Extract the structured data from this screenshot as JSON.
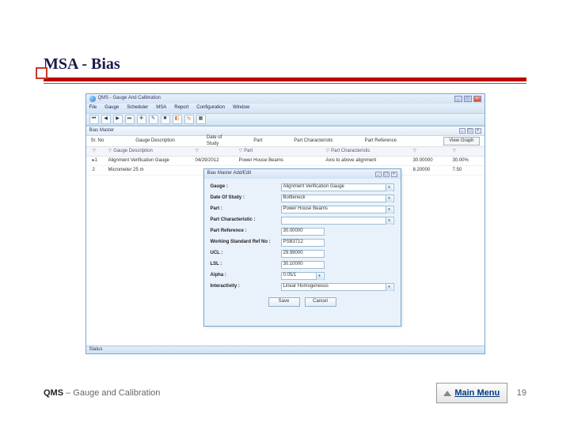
{
  "slide": {
    "title": "MSA - Bias",
    "footer_left_prefix": "QMS",
    "footer_left_rest": " – Gauge and Calibration",
    "main_menu_label": "Main Menu",
    "page_number": "19"
  },
  "window": {
    "title": "QMS - Gauge And Calibration",
    "menubar": [
      "File",
      "Gauge",
      "Scheduler",
      "MSA",
      "Report",
      "Configuration",
      "Window"
    ],
    "sub_title": "Bias Master",
    "header": {
      "srno_label": "Sr. No",
      "gauge_desc_label": "Gauge Description",
      "date_label": "Date of",
      "study_label": "Study",
      "part_label": "Part",
      "partchar_label": "Part Characteristic",
      "partref_label": "Part Reference",
      "view_graph": "View Graph"
    },
    "grid_cols": [
      "",
      "Gauge Description",
      "",
      "Part",
      "Part Characteristic",
      "",
      ""
    ],
    "rows": [
      {
        "sr": "1",
        "gauge": "Alignment Verification Gauge",
        "date": "04/29/2012",
        "part": "Power House Beams",
        "char": "Axis to above alignment",
        "ref": "30.00000",
        "pct": "30.00%"
      },
      {
        "sr": "2",
        "gauge": "Micrometer 25 m",
        "date": "",
        "part": "",
        "char": "",
        "ref": "8.20000",
        "pct": "7.50"
      }
    ],
    "status": "Status"
  },
  "dialog": {
    "title": "Bias Master Add/Edit",
    "fields": {
      "gauge_label": "Gauge :",
      "gauge_value": "Alignment Verification Gauge",
      "date_label": "Date Of Study :",
      "date_value": "Bottleneck",
      "part_label": "Part :",
      "part_value": "Power House Beams",
      "partchar_label": "Part Characteristic :",
      "partchar_value": "",
      "partref_label": "Part Reference :",
      "partref_value": "30.00000",
      "wsr_label": "Working Standard Ref No :",
      "wsr_value": "PSB3712",
      "ucl_label": "UCL :",
      "ucl_value": "29.99000",
      "lsl_label": "LSL :",
      "lsl_value": "30.10000",
      "alpha_label": "Alpha :",
      "alpha_value": "0.05/1",
      "inter_label": "Interactivity :",
      "inter_value": "Linear Homogeneous"
    },
    "buttons": {
      "save": "Save",
      "cancel": "Cancel"
    }
  }
}
